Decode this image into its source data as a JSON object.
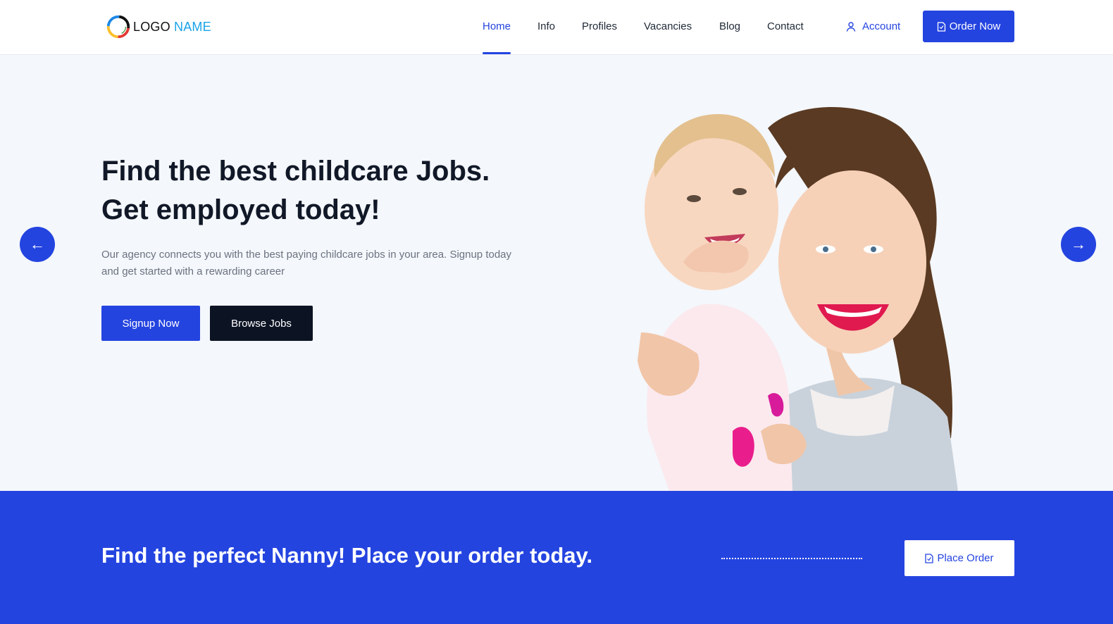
{
  "brand": {
    "logo_word1": "LOGO",
    "logo_word2": "NAME",
    "logo_icon": "multicolor-ring-icon"
  },
  "nav": {
    "items": [
      {
        "label": "Home",
        "active": true
      },
      {
        "label": "Info",
        "active": false
      },
      {
        "label": "Profiles",
        "active": false
      },
      {
        "label": "Vacancies",
        "active": false
      },
      {
        "label": "Blog",
        "active": false
      },
      {
        "label": "Contact",
        "active": false
      }
    ],
    "account_label": "Account",
    "account_icon": "user-icon",
    "order_button_label": "Order Now",
    "order_button_icon": "document-icon"
  },
  "hero": {
    "title_line1": "Find the best childcare Jobs.",
    "title_line2": "Get employed today!",
    "description": "Our agency connects you with the best paying childcare jobs in your area. Signup today and get started with a rewarding career",
    "signup_label": "Signup Now",
    "browse_label": "Browse Jobs",
    "prev_arrow": "←",
    "next_arrow": "→",
    "photo": "woman-holding-baby-photo"
  },
  "cta": {
    "text": "Find the perfect Nanny! Place your order today.",
    "button_label": "Place Order",
    "button_icon": "document-icon"
  },
  "colors": {
    "accent": "#2444e0",
    "dark": "#0c1424",
    "hero_bg": "#f4f7fb"
  }
}
